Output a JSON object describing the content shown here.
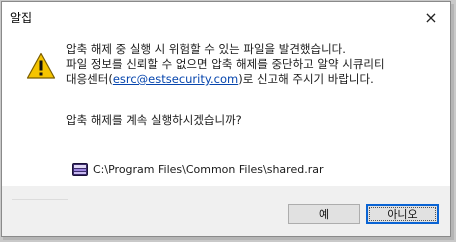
{
  "window": {
    "title": "알집",
    "close_glyph": "×"
  },
  "message": {
    "line1": "압축 해제 중 실행 시 위험할 수 있는 파일을 발견했습니다.",
    "line2": "파일 정보를 신뢰할 수 없으면 압축 해제를 중단하고 알약 시큐리티",
    "line3_prefix": "대응센터(",
    "email": "esrc@estsecurity.com",
    "line3_suffix": ")로 신고해 주시기 바랍니다.",
    "question": "압축 해제를 계속 실행하시겠습니까?"
  },
  "file": {
    "path": "C:\\Program Files\\Common Files\\shared.rar",
    "icon": "rar-archive-icon"
  },
  "buttons": {
    "yes": "예",
    "no": "아니오"
  },
  "icon": {
    "warning": "warning-icon",
    "warning_color": "#f5c400"
  }
}
